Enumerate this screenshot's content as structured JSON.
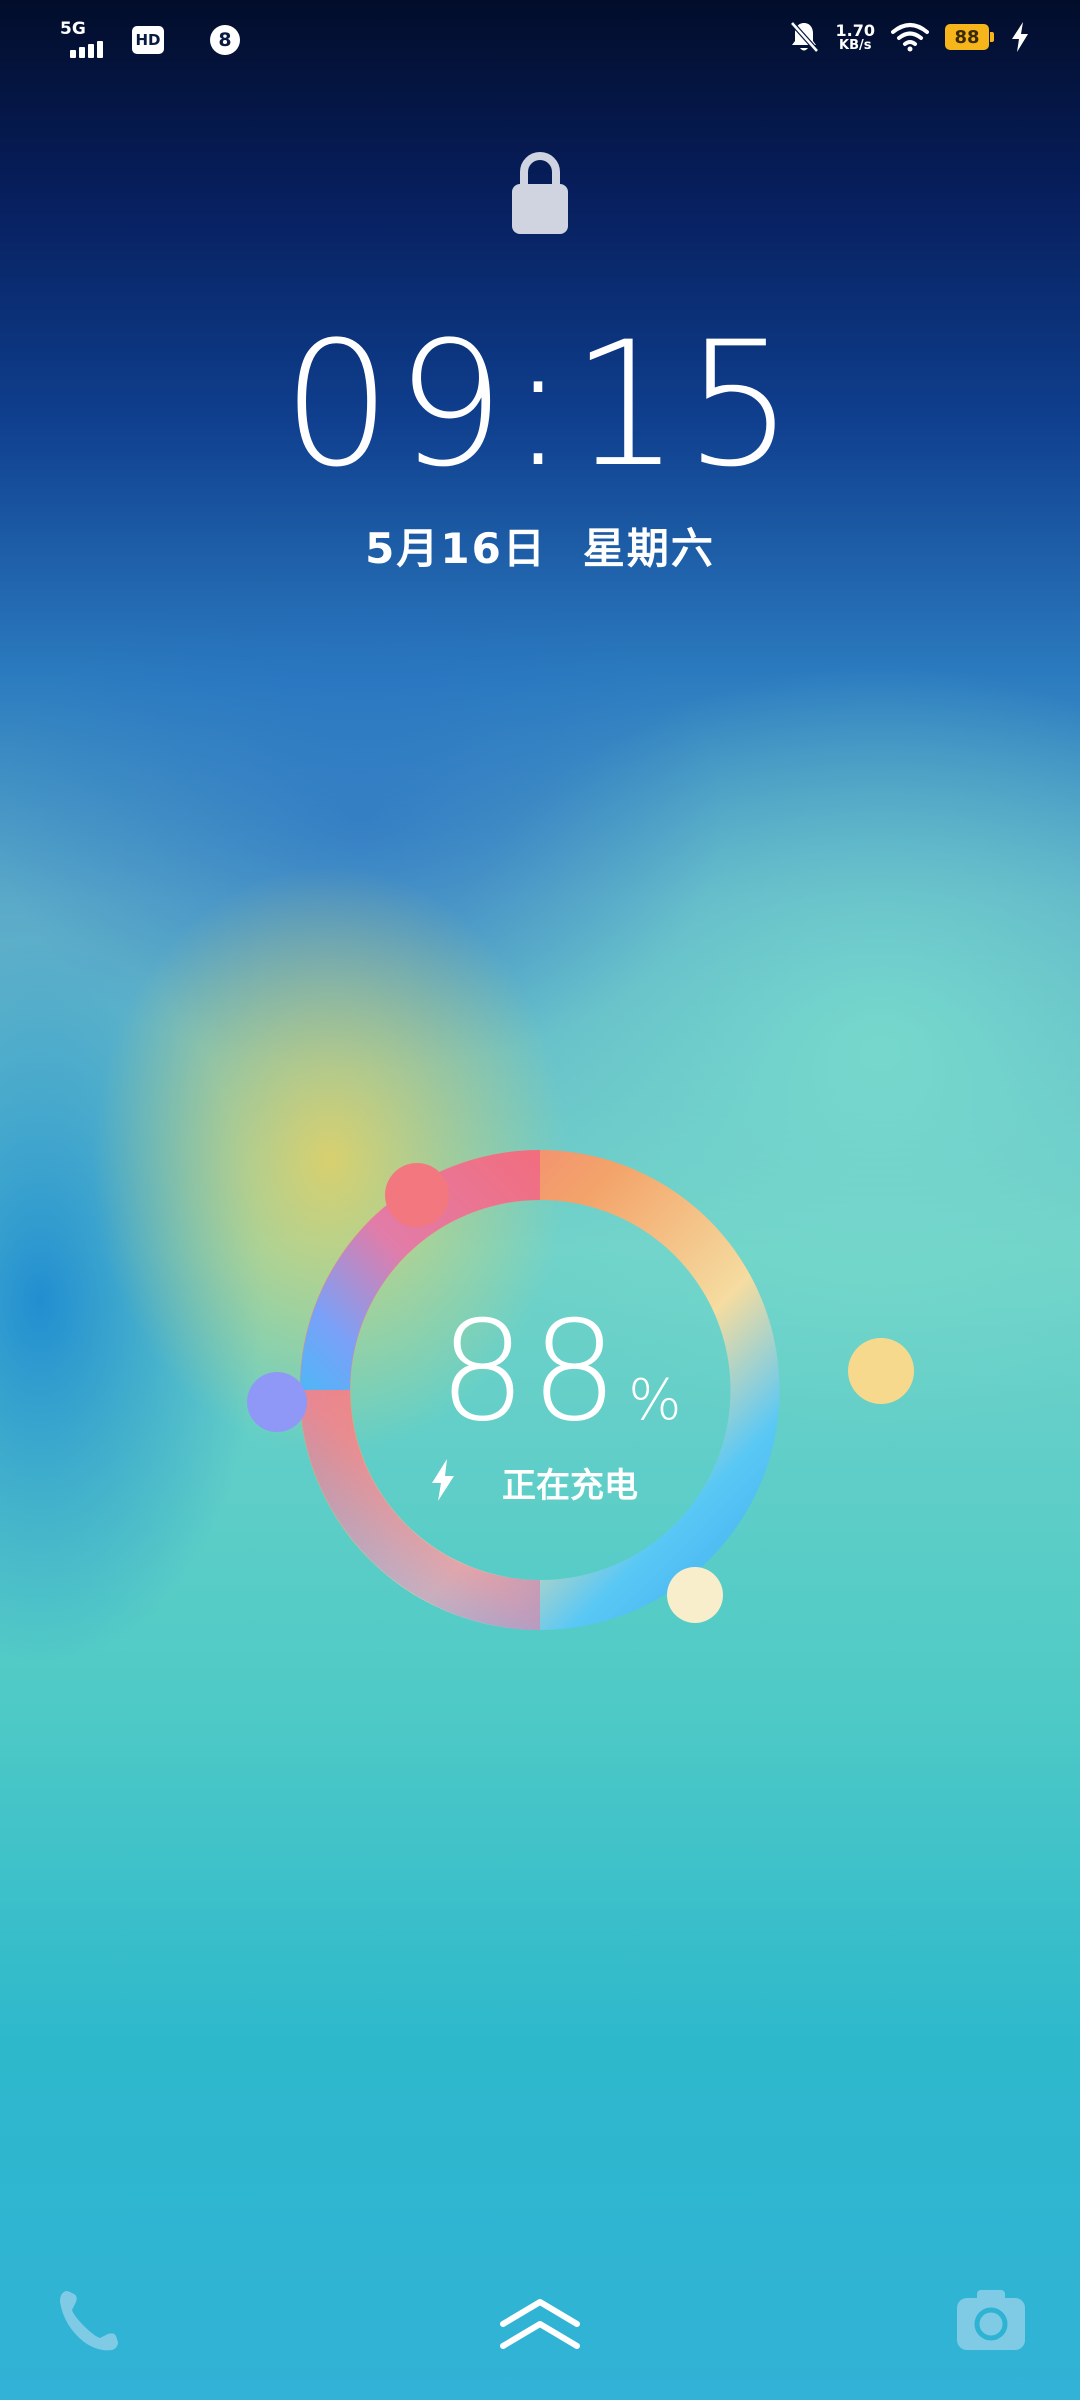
{
  "status_bar": {
    "network_type": "5G",
    "hd_label": "HD",
    "notification_count": "8",
    "net_speed_value": "1.70",
    "net_speed_unit": "KB/s",
    "battery_level": "88",
    "icons": [
      "signal-icon",
      "hd-icon",
      "notification-badge",
      "bell-muted-icon",
      "wifi-icon",
      "battery-icon",
      "charging-bolt-icon"
    ]
  },
  "lockscreen": {
    "lock_icon": "lock-icon",
    "time": "09:15",
    "date": "5月16日",
    "weekday": "星期六"
  },
  "charging": {
    "percent_value": "88",
    "percent_sign": "%",
    "status_text": "正在充电",
    "ring_colors": [
      "#f26d7d",
      "#f3a46a",
      "#f5dca0",
      "#5ac8f5",
      "#7aa0f8",
      "#e27ca8"
    ]
  },
  "bottom_bar": {
    "icons": [
      "phone-icon",
      "unlock-chevron-icon",
      "camera-icon"
    ]
  },
  "colors": {
    "battery_fill": "#f5b51b",
    "orb": "#ffd98a"
  }
}
